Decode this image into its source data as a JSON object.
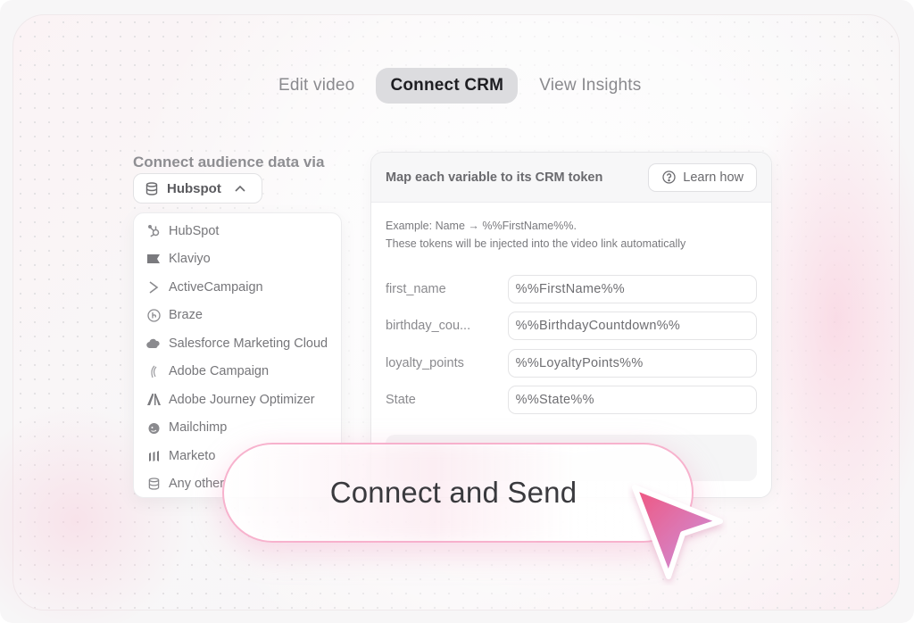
{
  "tabs": [
    {
      "label": "Edit video",
      "active": false
    },
    {
      "label": "Connect CRM",
      "active": true
    },
    {
      "label": "View Insights",
      "active": false
    }
  ],
  "left": {
    "connect_label": "Connect audience data via",
    "selected_crm": "Hubspot",
    "options": [
      {
        "label": "HubSpot",
        "icon": "hubspot-icon"
      },
      {
        "label": "Klaviyo",
        "icon": "klaviyo-flag-icon"
      },
      {
        "label": "ActiveCampaign",
        "icon": "activecampaign-chevron-icon"
      },
      {
        "label": "Braze",
        "icon": "braze-icon"
      },
      {
        "label": "Salesforce Marketing Cloud",
        "icon": "salesforce-cloud-icon"
      },
      {
        "label": "Adobe Campaign",
        "icon": "adobe-campaign-icon"
      },
      {
        "label": "Adobe Journey Optimizer",
        "icon": "adobe-icon"
      },
      {
        "label": "Mailchimp",
        "icon": "mailchimp-icon"
      },
      {
        "label": "Marketo",
        "icon": "marketo-icon"
      },
      {
        "label": "Any other",
        "icon": "database-icon"
      }
    ]
  },
  "panel": {
    "title": "Map each variable to its CRM token",
    "learn_label": "Learn how",
    "example_line1": "Example:  Name → %%FirstName%%.",
    "example_line2": "These tokens will be injected into the video link automatically",
    "mappings": [
      {
        "variable": "first_name",
        "token": "%%FirstName%%"
      },
      {
        "variable": "birthday_cou...",
        "token": "%%BirthdayCountdown%%"
      },
      {
        "variable": "loyalty_points",
        "token": "%%LoyaltyPoints%%"
      },
      {
        "variable": "State",
        "token": "%%State%%"
      }
    ]
  },
  "cta": {
    "label": "Connect and Send"
  },
  "colors": {
    "accent_pink": "#f0609a",
    "cursor_gradient_start": "#f0567f",
    "cursor_gradient_end": "#c898e8"
  }
}
